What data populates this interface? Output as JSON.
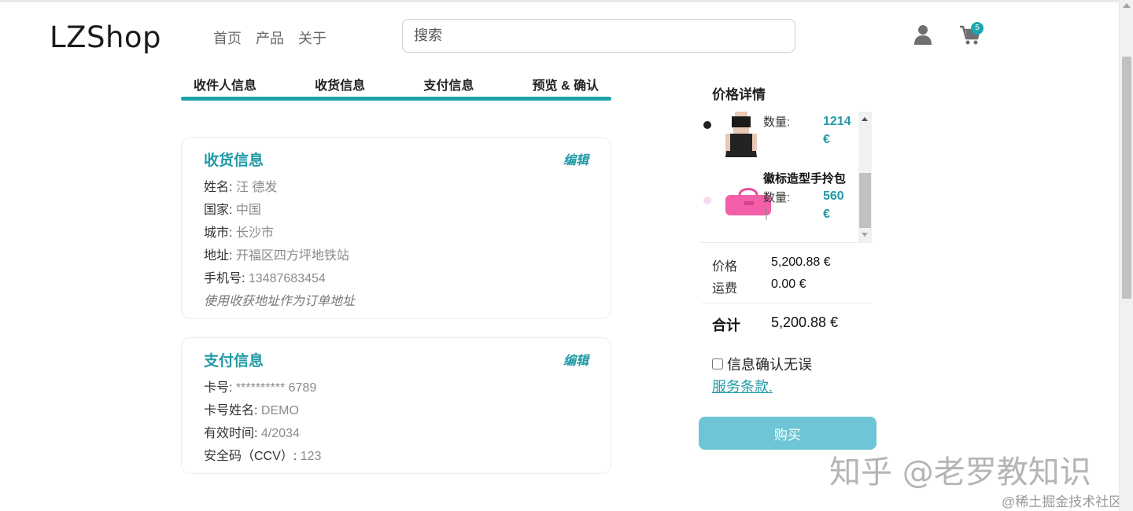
{
  "header": {
    "logo": "LZShop",
    "nav": [
      "首页",
      "产品",
      "关于"
    ],
    "search_placeholder": "搜索",
    "cart_count": "5"
  },
  "steps": [
    "收件人信息",
    "收货信息",
    "支付信息",
    "预览 & 确认"
  ],
  "shipping": {
    "title": "收货信息",
    "edit": "编辑",
    "rows": [
      {
        "label": "姓名: ",
        "value": "汪 德发"
      },
      {
        "label": "国家: ",
        "value": "中国"
      },
      {
        "label": "城市: ",
        "value": "长沙市"
      },
      {
        "label": "地址: ",
        "value": "开福区四方坪地铁站"
      },
      {
        "label": "手机号: ",
        "value": "13487683454"
      }
    ],
    "note": "使用收获地址作为订单地址"
  },
  "payment": {
    "title": "支付信息",
    "edit": "编辑",
    "rows": [
      {
        "label": "卡号: ",
        "value": "********** 6789"
      },
      {
        "label": "卡号姓名: ",
        "value": "DEMO"
      },
      {
        "label": "有效时间: ",
        "value": "4/2034"
      },
      {
        "label": "安全码（CCV）: ",
        "value": "123"
      }
    ]
  },
  "price_panel": {
    "title": "价格详情",
    "items": [
      {
        "name": "",
        "qty_label": "数量:",
        "price": "1214 €",
        "dot_color": "#222222"
      },
      {
        "name": "徽标造型手拎包",
        "qty_label": "数量:",
        "price": "560 €",
        "dot_color": "#f3dcef"
      }
    ],
    "price_label": "价格",
    "price_value": "5,200.88 €",
    "shipping_label": "运费",
    "shipping_value": "0.00 €",
    "total_label": "合计",
    "total_value": "5,200.88 €",
    "confirm_label": "信息确认无误",
    "terms": "服务条款.",
    "buy": "购买"
  },
  "watermarks": {
    "main": "知乎 @老罗教知识",
    "corner": "@稀土掘金技术社区"
  }
}
